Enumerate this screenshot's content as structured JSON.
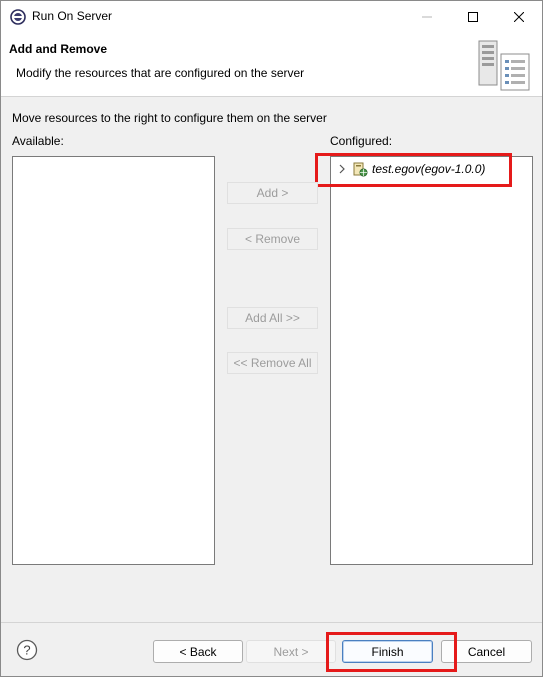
{
  "window": {
    "title": "Run On Server"
  },
  "banner": {
    "title": "Add and Remove",
    "description": "Modify the resources that are configured on the server"
  },
  "instructions": "Move resources to the right to configure them on the server",
  "available": {
    "label": "Available:",
    "items": []
  },
  "configured": {
    "label": "Configured:",
    "items": [
      {
        "label": "test.egov(egov-1.0.0)",
        "icon": "web-project-icon"
      }
    ]
  },
  "transfer_buttons": {
    "add": "Add >",
    "remove": "< Remove",
    "add_all": "Add All >>",
    "remove_all": "<< Remove All"
  },
  "footer": {
    "back": "< Back",
    "next": "Next >",
    "finish": "Finish",
    "cancel": "Cancel"
  },
  "colors": {
    "highlight": "#e51a1a",
    "default_button_border": "#4a7fc0"
  }
}
